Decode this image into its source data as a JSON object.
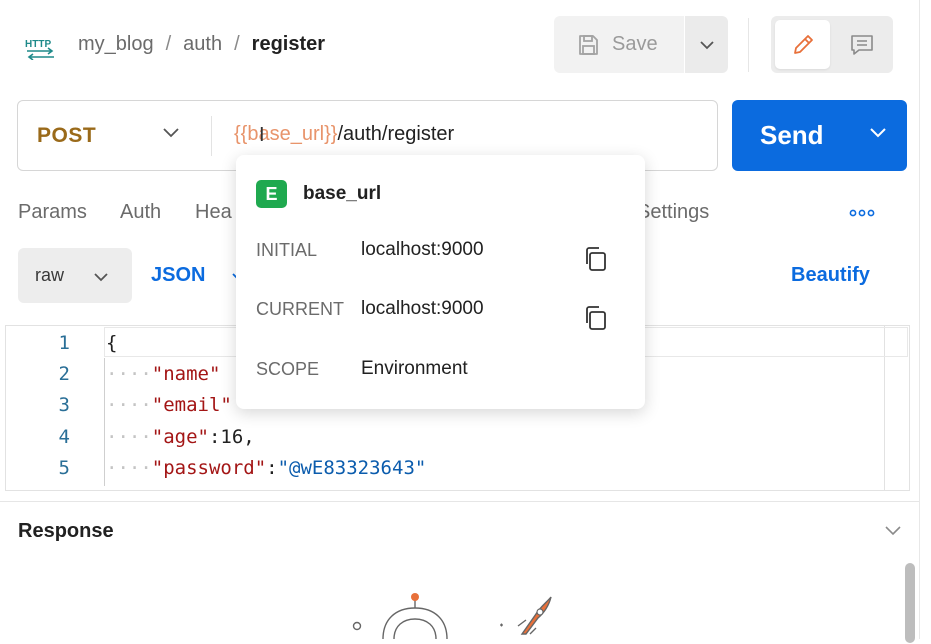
{
  "header": {
    "protocol_icon": "http-icon",
    "breadcrumb": [
      "my_blog",
      "auth",
      "register"
    ],
    "save_label": "Save"
  },
  "request": {
    "method": "POST",
    "url_variable": "{{base_url}}",
    "url_path": "/auth/register",
    "send_label": "Send"
  },
  "tabs": [
    "Params",
    "Auth",
    "Hea",
    "Settings"
  ],
  "body_toolbar": {
    "mode": "raw",
    "format": "JSON",
    "beautify_label": "Beautify"
  },
  "editor": {
    "line_numbers": [
      "1",
      "2",
      "3",
      "4",
      "5"
    ],
    "lines": [
      {
        "indent": "",
        "key": "{",
        "rest": ""
      },
      {
        "indent": "····",
        "key": "\"name\"",
        "rest": ""
      },
      {
        "indent": "····",
        "key": "\"email\"",
        "rest": ""
      },
      {
        "indent": "····",
        "key": "\"age\"",
        "rest": ":16,"
      },
      {
        "indent": "····",
        "key": "\"password\"",
        "rest": ":",
        "str": "\"@wE83323643\""
      }
    ]
  },
  "response": {
    "title": "Response"
  },
  "variable_popover": {
    "badge": "E",
    "name": "base_url",
    "rows": [
      {
        "label": "INITIAL",
        "value": "localhost:9000"
      },
      {
        "label": "CURRENT",
        "value": "localhost:9000"
      },
      {
        "label": "SCOPE",
        "value": "Environment"
      }
    ]
  },
  "colors": {
    "primary": "#0b6bdf",
    "method_post": "#9a6a1a",
    "variable": "#e8946b",
    "env_badge": "#1fa94f"
  }
}
